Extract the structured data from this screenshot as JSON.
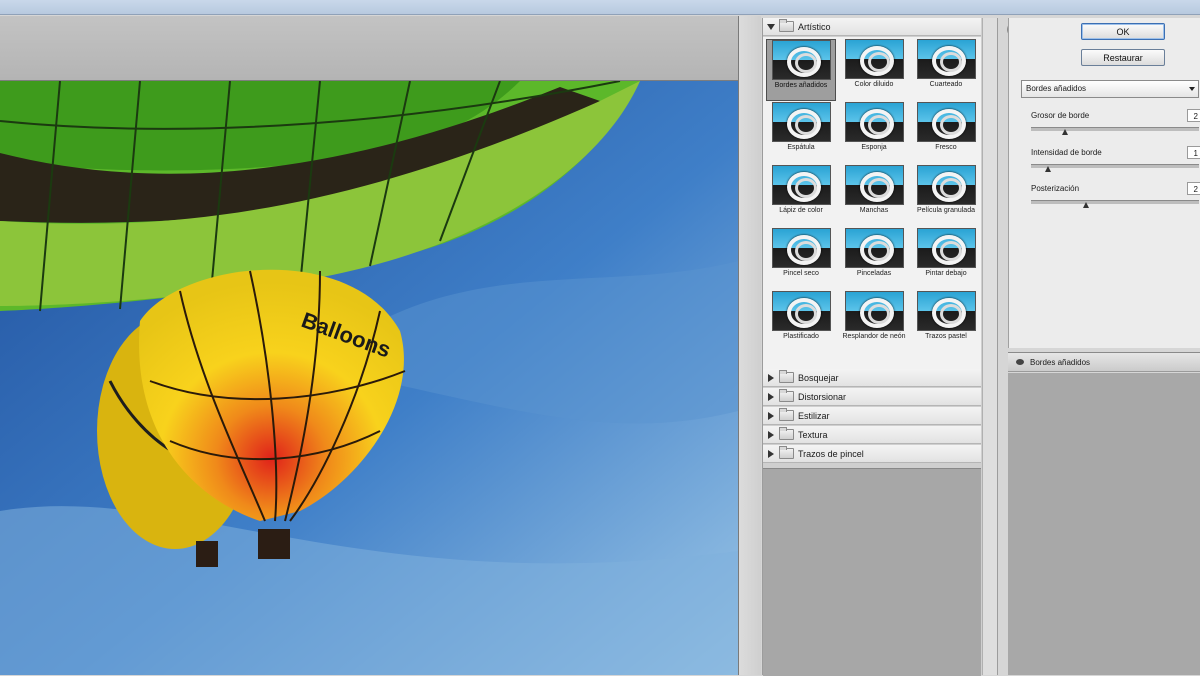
{
  "dialog": {
    "ok_label": "OK",
    "reset_label": "Restaurar"
  },
  "gallery": {
    "open_category": "Artístico",
    "thumbnails": [
      {
        "label": "Bordes añadidos",
        "selected": true
      },
      {
        "label": "Color diluido"
      },
      {
        "label": "Cuarteado"
      },
      {
        "label": "Espátula"
      },
      {
        "label": "Esponja"
      },
      {
        "label": "Fresco"
      },
      {
        "label": "Lápiz de color"
      },
      {
        "label": "Manchas"
      },
      {
        "label": "Película granulada"
      },
      {
        "label": "Pincel seco"
      },
      {
        "label": "Pinceladas"
      },
      {
        "label": "Pintar debajo"
      },
      {
        "label": "Plastificado"
      },
      {
        "label": "Resplandor de neón"
      },
      {
        "label": "Trazos pastel"
      }
    ],
    "collapsed_categories": [
      "Bosquejar",
      "Distorsionar",
      "Estilizar",
      "Textura",
      "Trazos de pincel"
    ]
  },
  "settings": {
    "filter_select": "Bordes añadidos",
    "params": [
      {
        "label": "Grosor de borde",
        "value": "2",
        "level": 0.2
      },
      {
        "label": "Intensidad de borde",
        "value": "1",
        "level": 0.1
      },
      {
        "label": "Posterización",
        "value": "2",
        "level": 0.33
      }
    ]
  },
  "layers": {
    "item": "Bordes añadidos"
  },
  "preview": {
    "balloon_text": "Balloons"
  }
}
